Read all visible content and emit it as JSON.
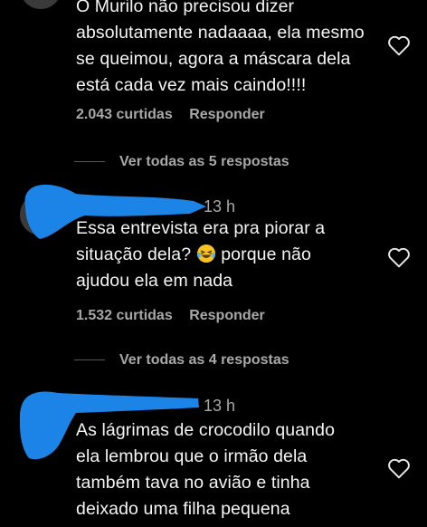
{
  "comments": [
    {
      "lines": [
        "O Murilo não precisou dizer",
        "absolutamente nadaaaa, ela mesmo",
        "se queimou, agora a máscara dela",
        "está cada vez mais caindo!!!!"
      ],
      "likes": "2.043 curtidas",
      "reply": "Responder",
      "view_replies": "Ver todas as 5 respostas"
    },
    {
      "time": "13 h",
      "lines": [
        "Essa entrevista era pra piorar a",
        "situação dela?",
        "porque não",
        "ajudou ela em nada"
      ],
      "likes": "1.532 curtidas",
      "reply": "Responder",
      "view_replies": "Ver todas as 4 respostas"
    },
    {
      "time": "13 h",
      "lines": [
        "As lágrimas de crocodilo quando",
        "ela lembrou que o irmão dela",
        "também tava no avião e tinha",
        "deixado uma filha pequena"
      ]
    }
  ],
  "icons": {
    "like": "heart-outline-icon",
    "emoji": "laughing-crying-emoji"
  },
  "colors": {
    "background": "#000000",
    "text": "#f5f5f5",
    "muted": "#a8a8a8",
    "redaction": "#1b84e6"
  }
}
